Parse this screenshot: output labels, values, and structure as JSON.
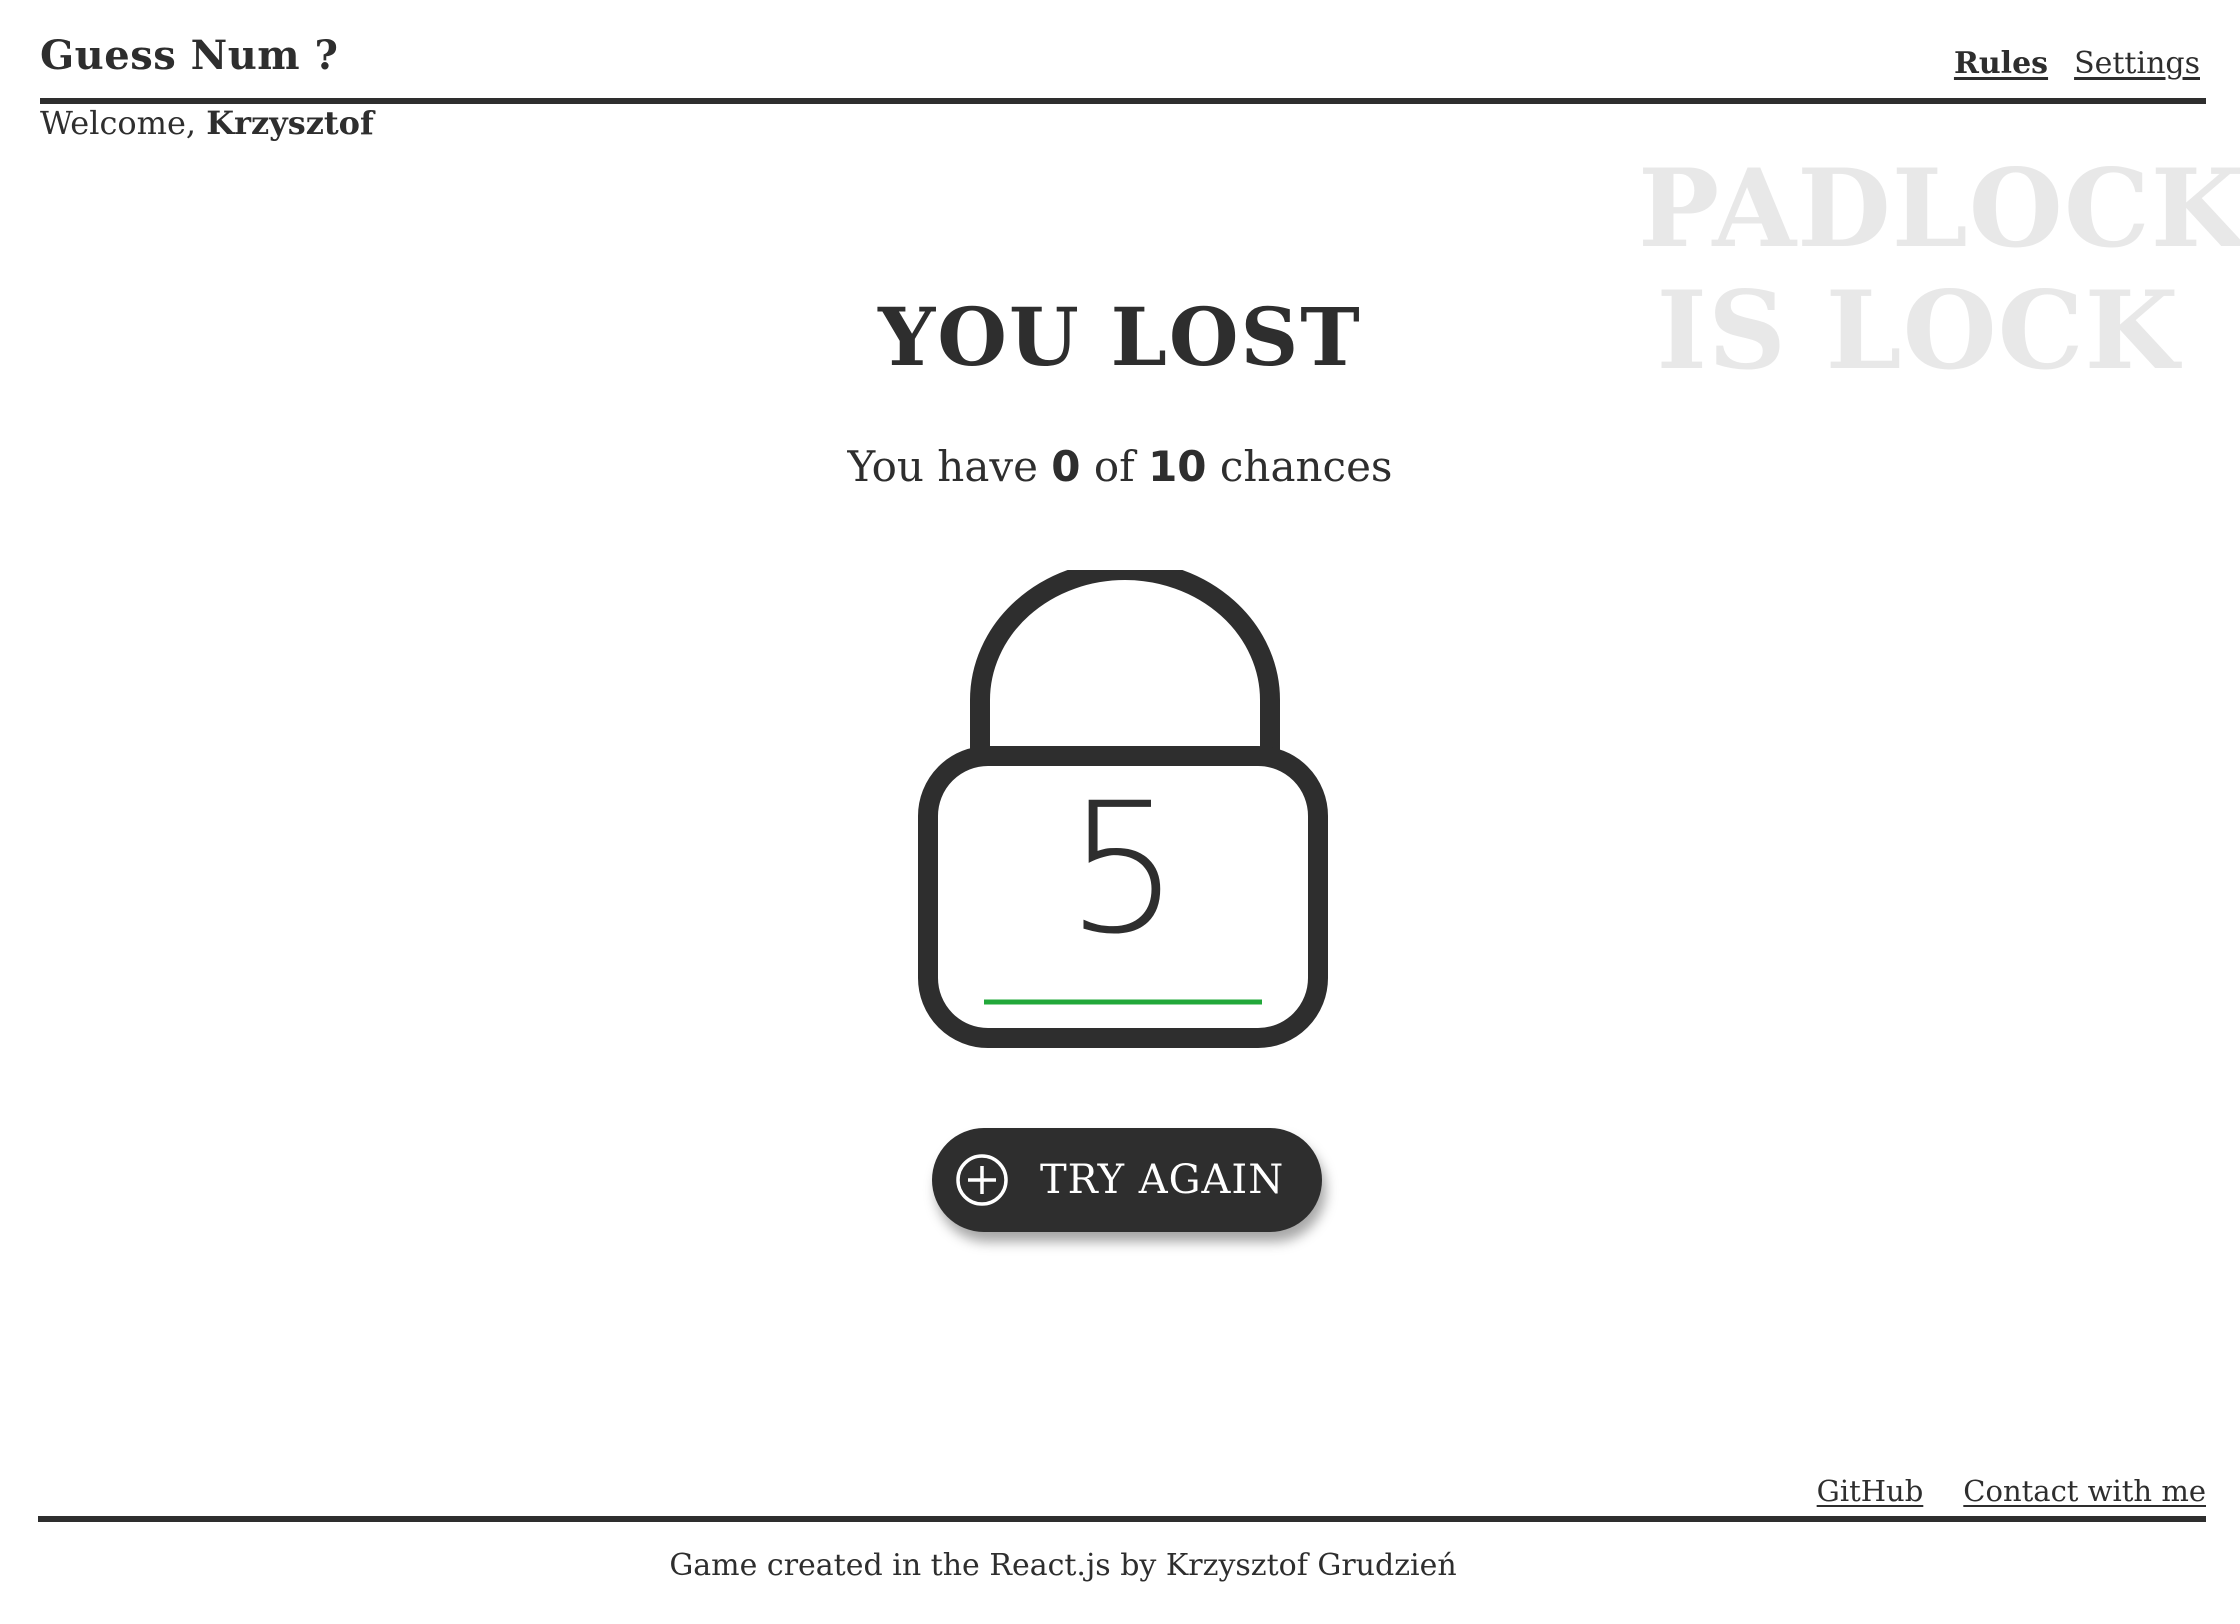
{
  "header": {
    "brand": "Guess Num ?",
    "nav": {
      "rules": "Rules",
      "settings": "Settings"
    }
  },
  "welcome": {
    "prefix": "Welcome, ",
    "username": "Krzysztof"
  },
  "watermark": {
    "line1": "PADLOCK",
    "line2": "IS LOCK"
  },
  "game": {
    "result_title": "YOU LOST",
    "chances": {
      "prefix": "You have ",
      "remaining": "0",
      "middle": " of ",
      "total": "10",
      "suffix": " chances"
    },
    "lock_number": "5",
    "underline_color": "#22a83a",
    "try_again_label": "TRY AGAIN",
    "try_again_icon": "plus-circle-icon"
  },
  "footer": {
    "github": "GitHub",
    "contact": "Contact with me",
    "credit": "Game created in the React.js by Krzysztof Grudzień"
  },
  "colors": {
    "primary": "#2e2e2e",
    "background": "#ffffff",
    "watermark": "#e8e8e8",
    "accent": "#22a83a"
  }
}
